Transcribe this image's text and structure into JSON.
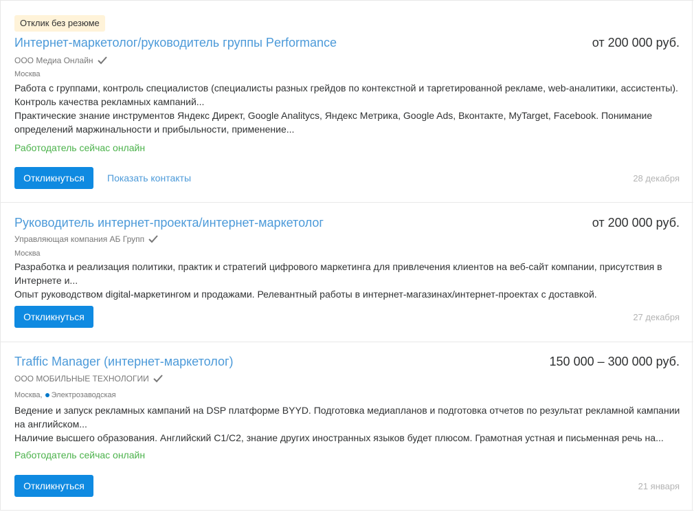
{
  "vacancies": [
    {
      "badge": "Отклик без резюме",
      "title": "Интернет-маркетолог/руководитель группы Performance",
      "salary": "от 200 000 руб.",
      "company": "ООО Медиа Онлайн",
      "verified_icon": "check-icon",
      "city": "Москва",
      "metro": "",
      "responsibility": "Работа с группами, контроль специалистов (специалисты разных грейдов по контекстной и таргетированной рекламе, web-аналитики, ассистенты). Контроль качества рекламных кампаний...",
      "requirement": "Практические знание инструментов Яндекс Директ, Google Analitycs, Яндекс Метрика, Google Ads, Вконтакте, MyTarget, Facebook. Понимание определений маржинальности и прибыльности, применение...",
      "online_status": "Работодатель сейчас онлайн",
      "respond_label": "Откликнуться",
      "contacts_label": "Показать контакты",
      "date": "28 декабря"
    },
    {
      "badge": "",
      "title": "Руководитель интернет-проекта/интернет-маркетолог",
      "salary": "от 200 000 руб.",
      "company": "Управляющая компания АБ Групп",
      "verified_icon": "check-icon",
      "city": "Москва",
      "metro": "",
      "responsibility": "Разработка и реализация политики, практик и стратегий цифрового маркетинга для привлечения клиентов на веб-сайт компании, присутствия в Интернете и...",
      "requirement": "Опыт руководством digital-маркетингом и продажами. Релевантный работы в интернет-магазинах/интернет-проектах с доставкой.",
      "online_status": "",
      "respond_label": "Откликнуться",
      "contacts_label": "",
      "date": "27 декабря"
    },
    {
      "badge": "",
      "title": "Traffic Manager (интернет-маркетолог)",
      "salary": "150 000 – 300 000 руб.",
      "company": "ООО МОБИЛЬНЫЕ ТЕХНОЛОГИИ",
      "verified_icon": "check-icon",
      "city": "Москва,",
      "metro": "Электрозаводская",
      "metro_color": "#0078c9",
      "responsibility": "Ведение и запуск рекламных кампаний на DSP платформе BYYD. Подготовка медиапланов и подготовка отчетов по результат рекламной кампании на английском...",
      "requirement": "Наличие высшего образования. Английский C1/C2, знание других иностранных языков будет плюсом. Грамотная устная и письменная речь на...",
      "online_status": "Работодатель сейчас онлайн",
      "respond_label": "Откликнуться",
      "contacts_label": "",
      "date": "21 января"
    }
  ],
  "colors": {
    "title_link": "#4c9ad9",
    "button_bg": "#0f8ae1",
    "online_green": "#4bb24b",
    "badge_bg": "#fff3d9",
    "date_gray": "#b4b4b4",
    "metro_line": "#0078c9"
  }
}
